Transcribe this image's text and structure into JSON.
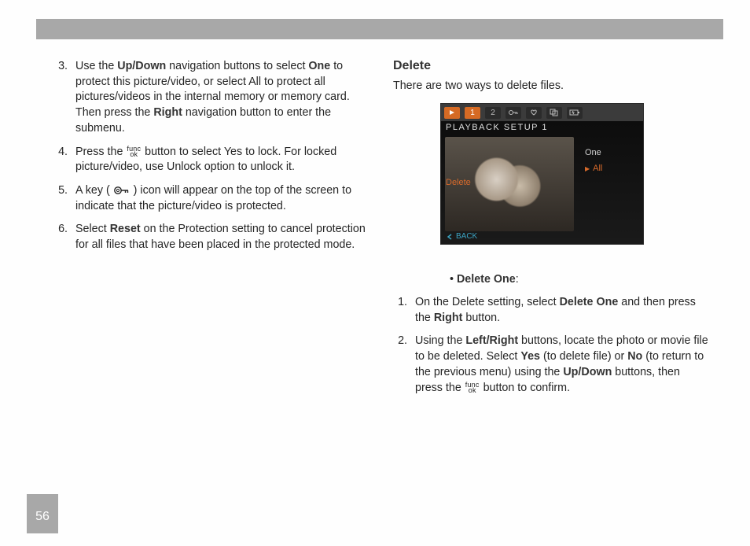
{
  "page_number": "56",
  "left": {
    "items": [
      {
        "n": "3.",
        "pre": "Use the ",
        "b1": "Up/Down",
        "mid1": " navigation buttons to select ",
        "b2": "One",
        "mid2": " to protect this picture/video, or select All to protect all pictures/videos in the internal memory or memory card. Then press the ",
        "b3": "Right",
        "post": " navigation button to enter the submenu."
      },
      {
        "n": "4.",
        "pre": "Press the ",
        "fn": true,
        "mid1": " button to select Yes to lock. For locked picture/video, use Unlock option to unlock it."
      },
      {
        "n": "5.",
        "pre": "A key ( ",
        "keyicon": true,
        "mid1": " ) icon will appear on the top of the screen to indicate that the picture/video is protected."
      },
      {
        "n": "6.",
        "pre": "Select ",
        "b1": "Reset",
        "mid1": " on the Protection setting to cancel protection for all files that have been placed in the protected mode."
      }
    ]
  },
  "right": {
    "heading": "Delete",
    "intro": "There are two ways to delete files.",
    "camera": {
      "tab1": "1",
      "tab2": "2",
      "title": "PLAYBACK  SETUP  1",
      "menu": "Delete",
      "opt1": "One",
      "opt2": "All",
      "back": "BACK"
    },
    "bullet_label": "Delete One",
    "items": [
      {
        "n": "1.",
        "pre": "On the Delete setting, select ",
        "b1": "Delete One",
        "mid1": " and then press the ",
        "b2": "Right",
        "post": " button."
      },
      {
        "n": "2.",
        "pre": "Using the ",
        "b1": "Left/Right",
        "mid1": " buttons, locate the photo or movie file to be deleted. Select ",
        "b2": "Yes",
        "mid2": " (to delete file) or ",
        "b3": "No",
        "mid3": " (to return to the previous menu) using the ",
        "b4": "Up/Down",
        "mid4": " buttons, then press the ",
        "fn": true,
        "post": " button to confirm."
      }
    ]
  },
  "func_label": {
    "top": "func",
    "bot": "ok"
  }
}
